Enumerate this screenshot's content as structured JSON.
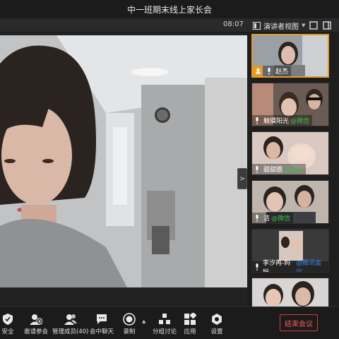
{
  "window": {
    "title": "中一班期末线上家长会"
  },
  "toolbar": {
    "time": "08:07",
    "view_label": "演讲者视图"
  },
  "participants": [
    {
      "name": "赵杰",
      "host": true
    },
    {
      "name": "触摸阳光",
      "suffix": "@微信"
    },
    {
      "name": "甜甜圈",
      "suffix": "@微信"
    },
    {
      "name": "洁",
      "suffix": "@微信"
    },
    {
      "name": "李汐再-妈妈",
      "suffix": "@腾讯会议"
    },
    {
      "name": "",
      "suffix": ""
    }
  ],
  "bottom": {
    "security": "安全",
    "invite": "邀请参会",
    "manage": "管理成员(40)",
    "chat": "会中聊天",
    "record": "录制",
    "breakout": "分组讨论",
    "apps": "应用",
    "settings": "设置",
    "end_meeting": "结束会议"
  },
  "colors": {
    "accent_orange": "#e69a2b",
    "end_red": "#d23d3d",
    "wechat_green": "#3ec04b",
    "tencent_blue": "#3a8fe8"
  }
}
